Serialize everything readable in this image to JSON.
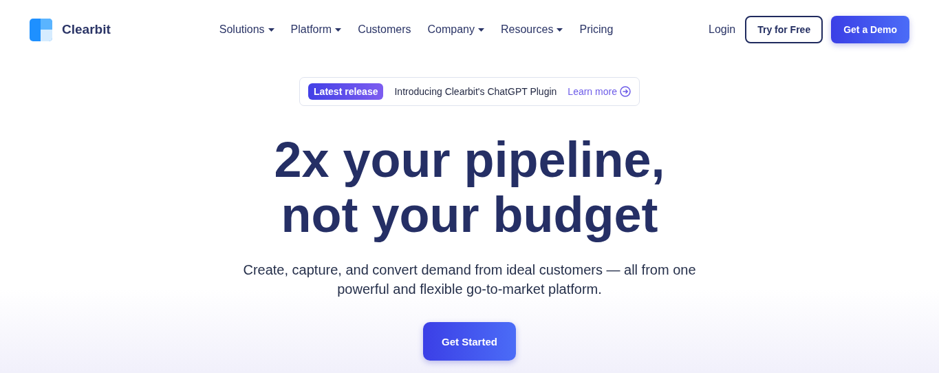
{
  "brand": {
    "name": "Clearbit"
  },
  "nav": [
    {
      "label": "Solutions",
      "has_menu": true
    },
    {
      "label": "Platform",
      "has_menu": true
    },
    {
      "label": "Customers",
      "has_menu": false
    },
    {
      "label": "Company",
      "has_menu": true
    },
    {
      "label": "Resources",
      "has_menu": true
    },
    {
      "label": "Pricing",
      "has_menu": false
    }
  ],
  "actions": [
    {
      "label": "Login",
      "kind": "link"
    },
    {
      "label": "Try for Free",
      "kind": "outline"
    },
    {
      "label": "Get a Demo",
      "kind": "primary"
    }
  ],
  "announcement": {
    "badge": "Latest release",
    "text": "Introducing Clearbit's ChatGPT Plugin",
    "link": "Learn more"
  },
  "hero": {
    "headline": [
      "2x your pipeline,",
      "not your budget"
    ],
    "subtitle": "Create, capture, and convert demand from ideal customers — all from one powerful and flexible go-to-market platform.",
    "cta": "Get Started"
  }
}
